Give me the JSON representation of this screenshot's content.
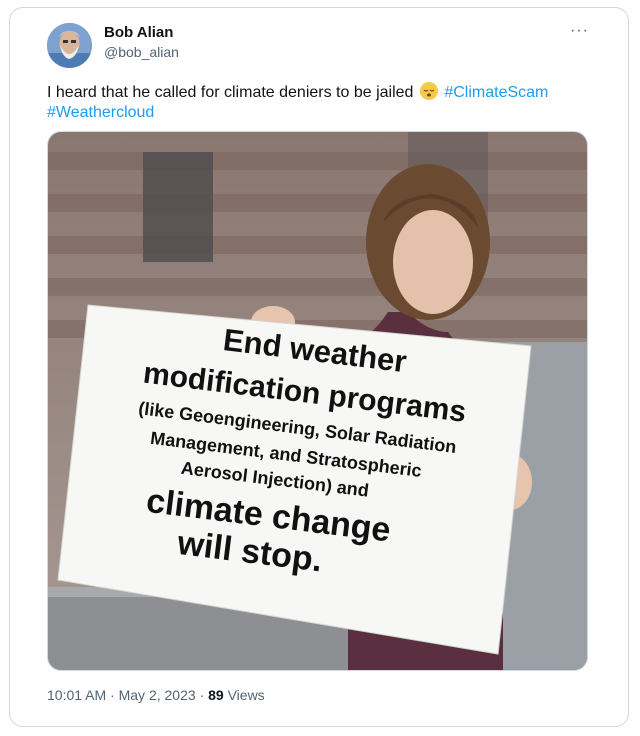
{
  "author": {
    "name": "Bob Alian",
    "handle": "@bob_alian"
  },
  "menu_icon": "more-horizontal-icon",
  "tweet": {
    "text": "I heard that he called for climate deniers to be jailed",
    "emoji": "sleeping-face-emoji",
    "hashtags": [
      "#ClimateScam",
      "#Weathercloud"
    ]
  },
  "sign": {
    "line1": "End weather",
    "line2": "modification programs",
    "line3": "(like Geoengineering, Solar Radiation",
    "line4": "Management, and Stratospheric",
    "line5": "Aerosol Injection) and",
    "line6": "climate change",
    "line7": "will stop."
  },
  "meta": {
    "time": "10:01 AM",
    "date": "May 2, 2023",
    "views_count": "89",
    "views_label": "Views",
    "separator": "·"
  }
}
